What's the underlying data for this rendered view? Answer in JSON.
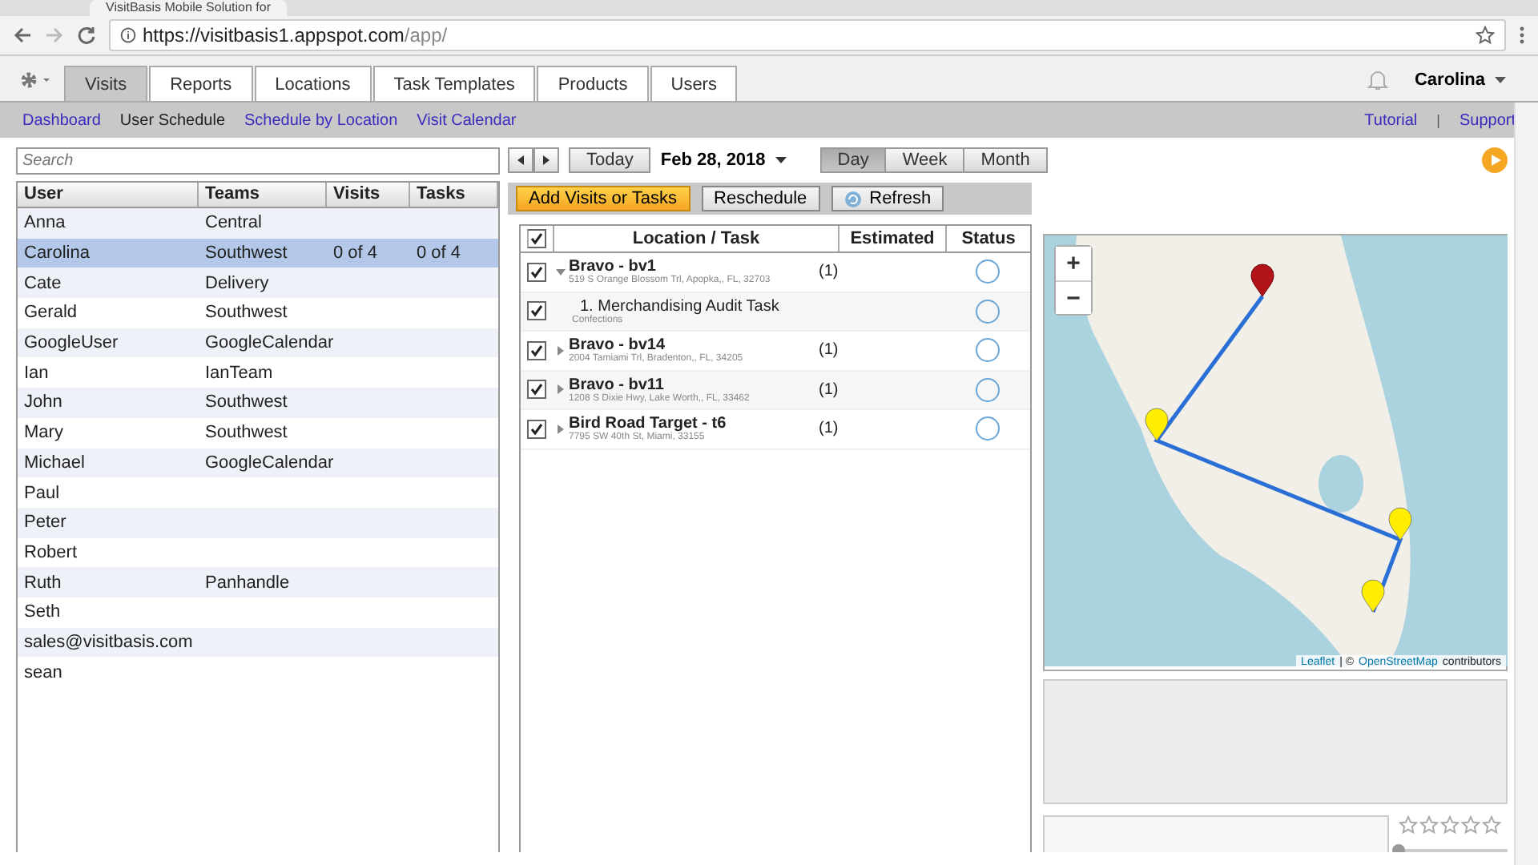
{
  "browser": {
    "tab_title": "VisitBasis Mobile Solution for",
    "url_host": "https://visitbasis1.appspot.com",
    "url_path": "/app/"
  },
  "nav_tabs": [
    {
      "label": "Visits",
      "selected": true
    },
    {
      "label": "Reports",
      "selected": false
    },
    {
      "label": "Locations",
      "selected": false
    },
    {
      "label": "Task Templates",
      "selected": false
    },
    {
      "label": "Products",
      "selected": false
    },
    {
      "label": "Users",
      "selected": false
    }
  ],
  "account": {
    "user": "Carolina"
  },
  "sub_nav": [
    {
      "label": "Dashboard",
      "selected": false
    },
    {
      "label": "User Schedule",
      "selected": true
    },
    {
      "label": "Schedule by Location",
      "selected": false
    },
    {
      "label": "Visit Calendar",
      "selected": false
    }
  ],
  "help_links": [
    "Tutorial",
    "Support"
  ],
  "help_separator": "|",
  "search": {
    "placeholder": "Search"
  },
  "users_table": {
    "columns": [
      "User",
      "Teams",
      "Visits",
      "Tasks"
    ],
    "rows": [
      {
        "cells": [
          "Anna",
          "Central",
          "",
          ""
        ],
        "selected": false
      },
      {
        "cells": [
          "Carolina",
          "Southwest",
          "0 of 4",
          "0 of 4"
        ],
        "selected": true
      },
      {
        "cells": [
          "Cate",
          "Delivery",
          "",
          ""
        ],
        "selected": false
      },
      {
        "cells": [
          "Gerald",
          "Southwest",
          "",
          ""
        ],
        "selected": false
      },
      {
        "cells": [
          "GoogleUser",
          "GoogleCalendar",
          "",
          ""
        ],
        "selected": false
      },
      {
        "cells": [
          "Ian",
          "IanTeam",
          "",
          ""
        ],
        "selected": false
      },
      {
        "cells": [
          "John",
          "Southwest",
          "",
          ""
        ],
        "selected": false
      },
      {
        "cells": [
          "Mary",
          "Southwest",
          "",
          ""
        ],
        "selected": false
      },
      {
        "cells": [
          "Michael",
          "GoogleCalendar",
          "",
          ""
        ],
        "selected": false
      },
      {
        "cells": [
          "Paul",
          "",
          "",
          " "
        ],
        "selected": false
      },
      {
        "cells": [
          "Peter",
          "",
          "",
          ""
        ],
        "selected": false
      },
      {
        "cells": [
          "Robert",
          "",
          "",
          ""
        ],
        "selected": false
      },
      {
        "cells": [
          "Ruth",
          "Panhandle",
          "",
          ""
        ],
        "selected": false
      },
      {
        "cells": [
          "Seth",
          "",
          "",
          ""
        ],
        "selected": false
      },
      {
        "cells": [
          "sales@visitbasis.com",
          "",
          "",
          ""
        ],
        "selected": false
      },
      {
        "cells": [
          "sean",
          "",
          "",
          ""
        ],
        "selected": false
      }
    ]
  },
  "date_bar": {
    "today": "Today",
    "date": "Feb 28, 2018",
    "views": [
      {
        "label": "Day",
        "selected": true
      },
      {
        "label": "Week",
        "selected": false
      },
      {
        "label": "Month",
        "selected": false
      }
    ]
  },
  "actions": [
    {
      "label": "Add Visits or Tasks",
      "kind": "primary"
    },
    {
      "label": "Reschedule",
      "kind": "plain"
    },
    {
      "label": "Refresh",
      "kind": "refresh"
    }
  ],
  "visits_table": {
    "all_checked": true,
    "columns": [
      "Location / Task",
      "Estimated",
      "Status"
    ],
    "rows": [
      {
        "kind": "location",
        "checked": true,
        "expanded": true,
        "name": "Bravo - bv1",
        "detail": "519 S Orange Blossom Trl, Apopka,, FL, 32703",
        "count": "(1)"
      },
      {
        "kind": "task",
        "checked": true,
        "name": "1. Merchandising Audit Task",
        "detail": "Confections"
      },
      {
        "kind": "location",
        "checked": true,
        "expanded": false,
        "name": "Bravo - bv14",
        "detail": "2004 Tamiami Trl, Bradenton,, FL, 34205",
        "count": "(1)"
      },
      {
        "kind": "location",
        "checked": true,
        "expanded": false,
        "name": "Bravo - bv11",
        "detail": "1208 S Dixie Hwy, Lake Worth,, FL, 33462",
        "count": "(1)"
      },
      {
        "kind": "location",
        "checked": true,
        "expanded": false,
        "name": "Bird Road Target - t6",
        "detail": "7795 SW 40th St, Miami, 33155",
        "count": "(1)"
      }
    ]
  },
  "map": {
    "zoom_in": "+",
    "zoom_out": "−",
    "attribution_link": "Leaflet",
    "attribution_sep": "| ©",
    "attribution_osm": "OpenStreetMap",
    "attribution_rest": "contributors"
  },
  "rating": {
    "stars": 0,
    "level": 0
  }
}
